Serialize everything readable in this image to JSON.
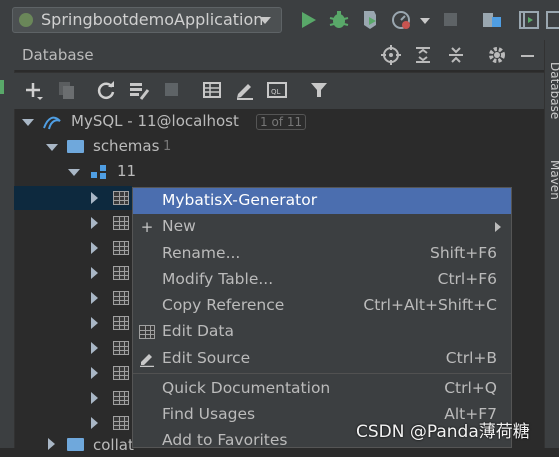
{
  "run_toolbar": {
    "config_name": "SpringbootdemoApplication"
  },
  "db_panel": {
    "title": "Database"
  },
  "tree": {
    "connection_label": "MySQL - 11@localhost",
    "connection_badge": "1 of 11",
    "schemas_label": "schemas",
    "schemas_count": "1",
    "schema_name": "11",
    "bottom_label": "collat"
  },
  "right_strip": {
    "database_tab": "Database",
    "maven_tab": "Maven"
  },
  "context_menu": {
    "items": [
      {
        "label": "MybatisX-Generator",
        "shortcut": ""
      },
      {
        "label": "New",
        "shortcut": ""
      },
      {
        "label": "Rename...",
        "shortcut": "Shift+F6"
      },
      {
        "label": "Modify Table...",
        "shortcut": "Ctrl+F6"
      },
      {
        "label": "Copy Reference",
        "shortcut": "Ctrl+Alt+Shift+C"
      },
      {
        "label": "Edit Data",
        "shortcut": ""
      },
      {
        "label": "Edit Source",
        "shortcut": "Ctrl+B"
      },
      {
        "label": "Quick Documentation",
        "shortcut": "Ctrl+Q"
      },
      {
        "label": "Find Usages",
        "shortcut": "Alt+F7"
      },
      {
        "label": "Add to Favorites",
        "shortcut": ""
      }
    ]
  },
  "watermark": "CSDN @Panda薄荷糖"
}
